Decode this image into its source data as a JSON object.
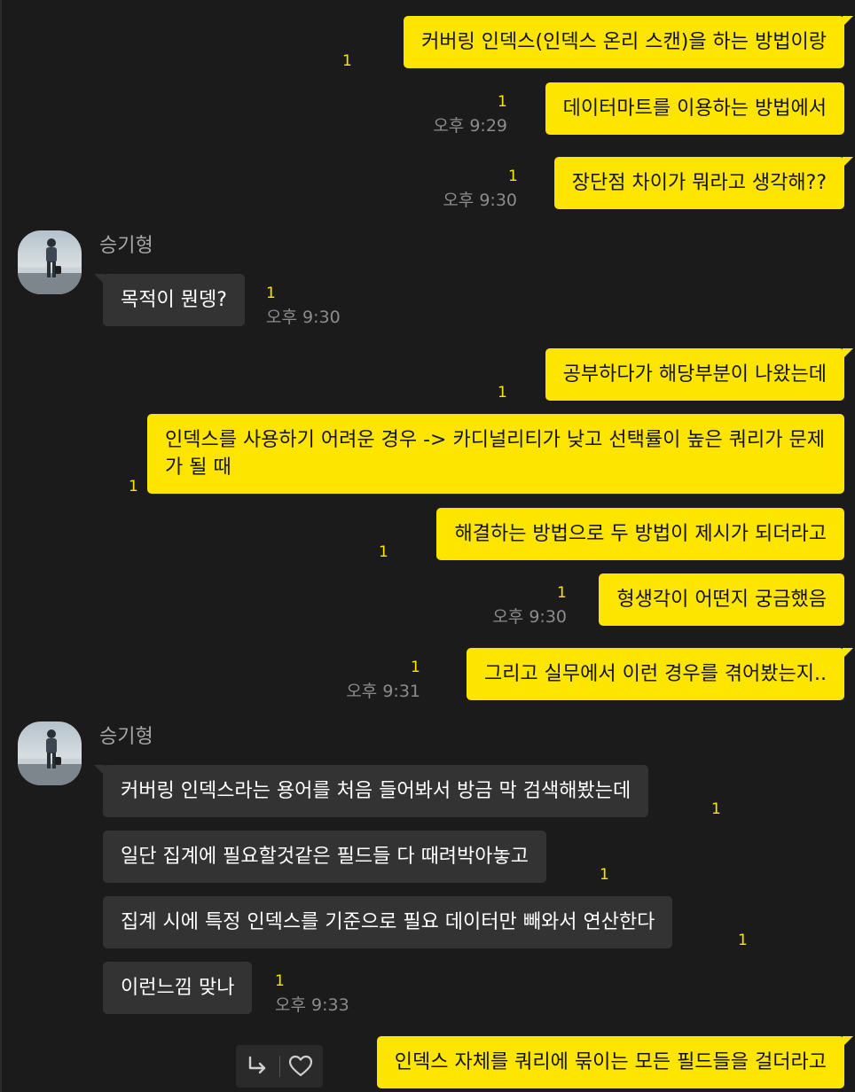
{
  "chat": {
    "sender_name": "승기형",
    "messages": [
      {
        "text": "커버링 인덱스(인덱스 온리 스캔)을 하는 방법이랑",
        "unread": "1"
      },
      {
        "text": "데이터마트를 이용하는 방법에서",
        "unread": "1",
        "time": "오후 9:29"
      },
      {
        "text": "장단점 차이가 뭐라고 생각해??",
        "unread": "1",
        "time": "오후 9:30"
      },
      {
        "text": "목적이 뭔뎅?",
        "unread": "1",
        "time": "오후 9:30"
      },
      {
        "text": "공부하다가 해당부분이 나왔는데",
        "unread": "1"
      },
      {
        "text": "인덱스를 사용하기 어려운 경우 -> 카디널리티가 낮고 선택률이 높은 쿼리가 문제가 될 때",
        "unread": "1"
      },
      {
        "text": "해결하는 방법으로 두 방법이 제시가 되더라고",
        "unread": "1"
      },
      {
        "text": "형생각이 어떤지 궁금했음",
        "unread": "1",
        "time": "오후 9:30"
      },
      {
        "text": "그리고 실무에서 이런 경우를 겪어봤는지..",
        "unread": "1",
        "time": "오후 9:31"
      },
      {
        "text": "커버링 인덱스라는 용어를 처음 들어봐서 방금 막 검색해봤는데",
        "unread": "1"
      },
      {
        "text": "일단 집계에 필요할것같은 필드들 다 때려박아놓고",
        "unread": "1"
      },
      {
        "text": "집계 시에 특정 인덱스를 기준으로 필요 데이터만 빼와서 연산한다",
        "unread": "1"
      },
      {
        "text": "이런느낌 맞나",
        "unread": "1",
        "time": "오후 9:33"
      },
      {
        "text": "인덱스 자체를 쿼리에 묶이는 모든 필드들을 걸더라고"
      }
    ]
  },
  "icons": {
    "reply": "reply-arrow-icon",
    "heart": "heart-icon",
    "avatar": "profile-photo"
  },
  "colors": {
    "background": "#1b1b1b",
    "my_bubble": "#fee500",
    "their_bubble": "#333333",
    "unread": "#fee500",
    "time": "#8c8c8c"
  }
}
